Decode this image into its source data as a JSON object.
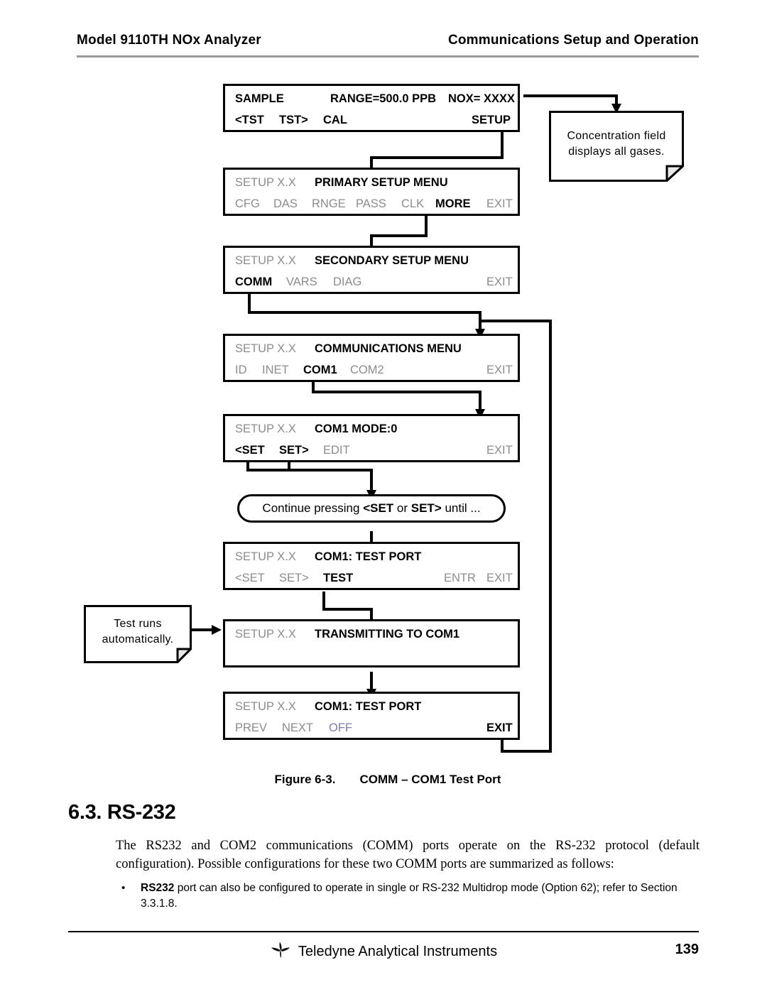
{
  "header": {
    "left": "Model 9110TH NOx Analyzer",
    "right": "Communications Setup and Operation"
  },
  "diagram": {
    "displays": [
      {
        "id": "sample-display",
        "row1": [
          {
            "text": "SAMPLE",
            "style": "b"
          },
          {
            "text": "RANGE=500.0 PPB",
            "style": "b"
          },
          {
            "text": "NOX= XXXX",
            "style": "b"
          }
        ],
        "row2": [
          {
            "text": "<TST",
            "style": "b"
          },
          {
            "text": "TST>",
            "style": "b"
          },
          {
            "text": "CAL",
            "style": "b"
          },
          {
            "text": "SETUP",
            "style": "b"
          }
        ]
      },
      {
        "id": "primary-setup-menu",
        "row1": [
          {
            "text": "SETUP X.X",
            "style": "g"
          },
          {
            "text": "PRIMARY SETUP MENU",
            "style": "b"
          }
        ],
        "row2": [
          {
            "text": "CFG",
            "style": "g"
          },
          {
            "text": "DAS",
            "style": "g"
          },
          {
            "text": "RNGE",
            "style": "g"
          },
          {
            "text": "PASS",
            "style": "g"
          },
          {
            "text": "CLK",
            "style": "g"
          },
          {
            "text": "MORE",
            "style": "b"
          },
          {
            "text": "EXIT",
            "style": "g"
          }
        ]
      },
      {
        "id": "secondary-setup-menu",
        "row1": [
          {
            "text": "SETUP X.X",
            "style": "g"
          },
          {
            "text": "SECONDARY SETUP MENU",
            "style": "b"
          }
        ],
        "row2": [
          {
            "text": "COMM",
            "style": "b"
          },
          {
            "text": "VARS",
            "style": "g"
          },
          {
            "text": "DIAG",
            "style": "g"
          },
          {
            "text": "EXIT",
            "style": "g"
          }
        ]
      },
      {
        "id": "communications-menu",
        "row1": [
          {
            "text": "SETUP X.X",
            "style": "g"
          },
          {
            "text": "COMMUNICATIONS MENU",
            "style": "b"
          }
        ],
        "row2": [
          {
            "text": "ID",
            "style": "g"
          },
          {
            "text": "INET",
            "style": "g"
          },
          {
            "text": "COM1",
            "style": "b"
          },
          {
            "text": "COM2",
            "style": "g"
          },
          {
            "text": "EXIT",
            "style": "g"
          }
        ]
      },
      {
        "id": "com1-mode-display",
        "row1": [
          {
            "text": "SETUP X.X",
            "style": "g"
          },
          {
            "text": "COM1 MODE:0",
            "style": "b"
          }
        ],
        "row2": [
          {
            "text": "<SET",
            "style": "b"
          },
          {
            "text": "SET>",
            "style": "b"
          },
          {
            "text": "EDIT",
            "style": "g"
          },
          {
            "text": "EXIT",
            "style": "g"
          }
        ]
      },
      {
        "id": "com1-test-port-display",
        "row1": [
          {
            "text": "SETUP X.X",
            "style": "g"
          },
          {
            "text": "COM1: TEST PORT",
            "style": "b"
          }
        ],
        "row2": [
          {
            "text": "<SET",
            "style": "g"
          },
          {
            "text": "SET>",
            "style": "g"
          },
          {
            "text": "TEST",
            "style": "b"
          },
          {
            "text": "ENTR",
            "style": "g"
          },
          {
            "text": "EXIT",
            "style": "g"
          }
        ]
      },
      {
        "id": "transmitting-display",
        "row1": [
          {
            "text": "SETUP X.X",
            "style": "g"
          },
          {
            "text": "TRANSMITTING TO COM1",
            "style": "b"
          }
        ],
        "row2": []
      },
      {
        "id": "com1-test-port-off-display",
        "row1": [
          {
            "text": "SETUP X.X",
            "style": "g"
          },
          {
            "text": "COM1: TEST PORT",
            "style": "b"
          }
        ],
        "row2": [
          {
            "text": "PREV",
            "style": "g"
          },
          {
            "text": "NEXT",
            "style": "g"
          },
          {
            "text": "OFF",
            "style": "blue"
          },
          {
            "text": "EXIT",
            "style": "b"
          }
        ]
      }
    ],
    "capsule": {
      "prefix": "Continue pressing ",
      "key1": "<SET",
      "middle": " or ",
      "key2": "SET>",
      "suffix": " until ..."
    },
    "notes": [
      {
        "id": "concentration-note",
        "line1": "Concentration field",
        "line2": "displays all gases."
      },
      {
        "id": "test-runs-note",
        "line1": "Test runs",
        "line2": "automatically."
      }
    ]
  },
  "caption": {
    "number": "Figure 6-3.",
    "title": "COMM – COM1 Test Port"
  },
  "section": {
    "heading": "6.3. RS-232",
    "paragraph": "The RS232 and COM2 communications (COMM) ports operate on the RS-232 protocol (default configuration). Possible configurations for these two COMM ports are summarized as follows:",
    "bullets": [
      {
        "marker": "•",
        "lead": "RS232",
        "text": " port can also be configured to operate in single or RS-232 Multidrop mode (Option 62); refer to Section 3.3.1.8."
      }
    ]
  },
  "footer": {
    "company": "Teledyne Analytical Instruments",
    "page": "139"
  },
  "colors": {
    "gray_text": "#8c8c8c",
    "blue_text": "#7b7fa8",
    "line": "#000000",
    "rule": "#9a9a9a"
  }
}
